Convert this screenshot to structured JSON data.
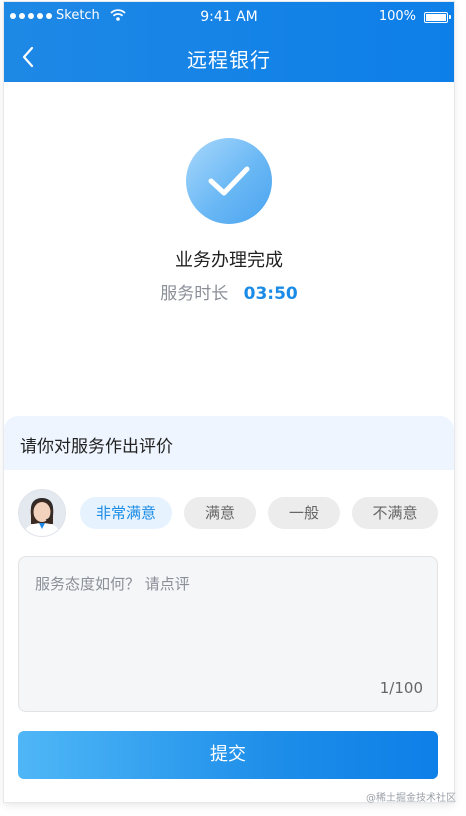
{
  "status_bar": {
    "carrier": "Sketch",
    "time": "9:41 AM",
    "battery": "100%"
  },
  "nav": {
    "title": "远程银行",
    "back_icon": "chevron-left-icon"
  },
  "result": {
    "icon": "check-icon",
    "title": "业务办理完成",
    "duration_label": "服务时长",
    "duration_value": "03:50"
  },
  "rating": {
    "title": "请你对服务作出评价",
    "options": [
      "非常满意",
      "满意",
      "一般",
      "不满意"
    ],
    "selected": "非常满意"
  },
  "comment": {
    "placeholder": "服务态度如何？ 请点评",
    "counter": "1/100"
  },
  "submit_label": "提交",
  "watermark": "@稀土掘金技术社区",
  "colors": {
    "brand": "#1e88e5",
    "accent": "#1a8be6",
    "chip_active_bg": "#e6f3ff",
    "chip_inactive_bg": "#ececec"
  }
}
